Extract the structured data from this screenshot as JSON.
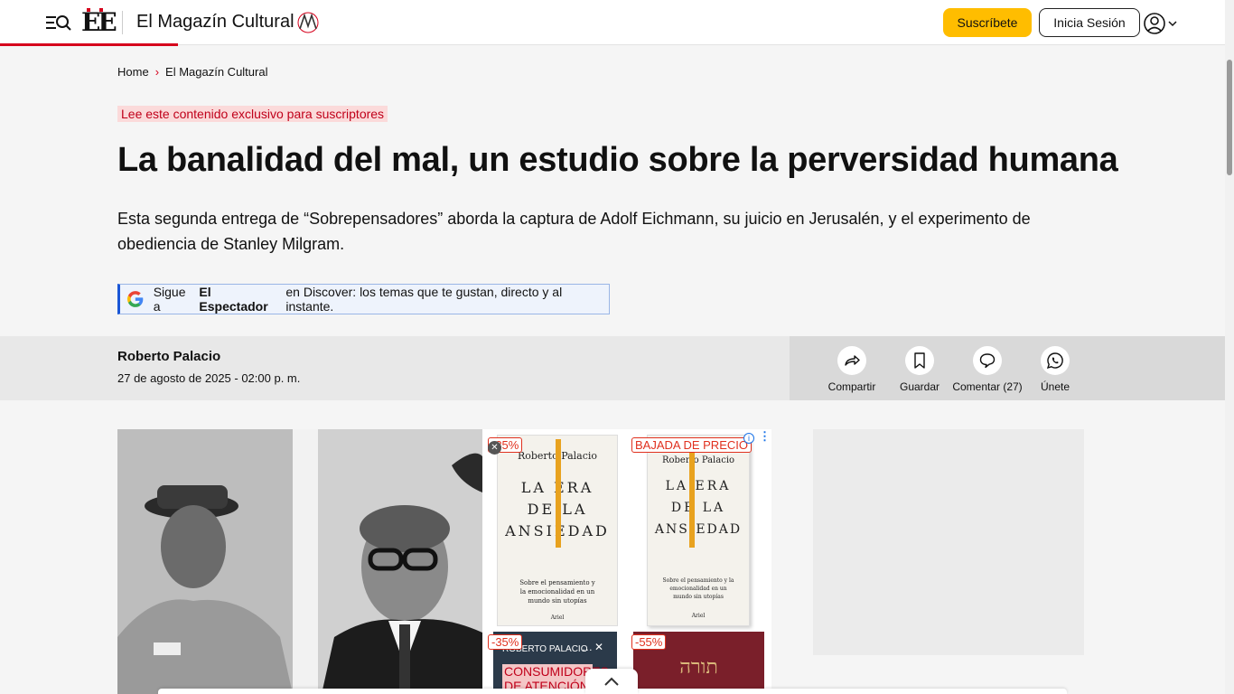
{
  "header": {
    "section_title": "El Magazín Cultural",
    "logo_text": "EE",
    "subscribe_label": "Suscríbete",
    "login_label": "Inicia Sesión",
    "brand_color": "#d6001c",
    "accent_color": "#ffbd00"
  },
  "breadcrumb": {
    "home": "Home",
    "section": "El Magazín Cultural"
  },
  "article": {
    "exclusive_label": "Lee este contenido exclusivo para suscriptores",
    "headline": "La banalidad del mal, un estudio sobre la perversidad humana",
    "summary": "Esta segunda entrega de “Sobrepensadores” aborda la captura de Adolf Eichmann, su juicio en Jerusalén, y el experimento de obediencia de Stanley Milgram.",
    "author": "Roberto Palacio",
    "date": "27 de agosto de 2025 - 02:00 p. m."
  },
  "discover": {
    "prefix": "Sigue a",
    "brand": "El Espectador",
    "suffix": "en Discover: los temas que te gustan, directo y al instante."
  },
  "actions": {
    "share": "Compartir",
    "save": "Guardar",
    "comment": "Comentar (27)",
    "join": "Únete"
  },
  "ad": {
    "badge1": "-35%",
    "badge2": "BAJADA DE PRECIO",
    "badge3": "-35%",
    "badge4": "-55%",
    "book_author": "Roberto Palacio",
    "book_title_1": "LA ERA",
    "book_title_2": "DE LA",
    "book_title_3": "ANSIEDAD",
    "book_subtitle": "Sobre el pensamiento y la emocionalidad en un mundo sin utopías",
    "publisher": "Ariel",
    "book2_author": "ROBERTO PALACIO",
    "book2_title": "CONSUMIDORES DE ATENCIÓN",
    "book3_title": "תורה"
  }
}
